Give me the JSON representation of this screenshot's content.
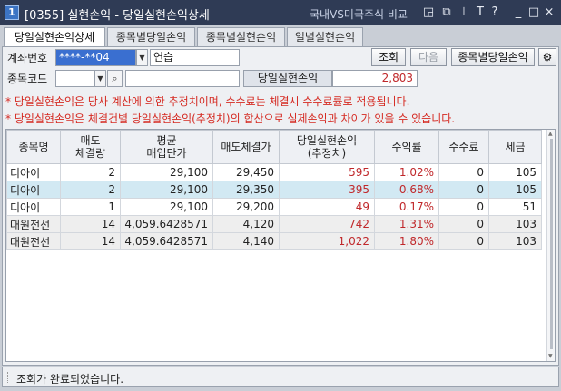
{
  "window": {
    "number_badge": "1",
    "title": "[0355] 실현손익 - 당일실현손익상세",
    "compare_link": "국내VS미국주식 비교",
    "controls": [
      "?",
      "_",
      "□",
      "×"
    ]
  },
  "tabs": [
    {
      "label": "당일실현손익상세",
      "active": true
    },
    {
      "label": "종목별당일손익",
      "active": false
    },
    {
      "label": "종목별실현손익",
      "active": false
    },
    {
      "label": "일별실현손익",
      "active": false
    }
  ],
  "form": {
    "account_label": "계좌번호",
    "account_value": "****-**04",
    "account_name": "연습",
    "stock_label": "종목코드",
    "stock_value": "",
    "stock_name": "",
    "query_button": "조회",
    "next_button": "다음",
    "by_stock_button": "종목별당일손익",
    "sum_label": "당일실현손익",
    "sum_value": "2,803"
  },
  "notices": [
    "* 당일실현손익은 당사 계산에 의한 추정치이며, 수수료는 체결시 수수료률로 적용됩니다.",
    "* 당일실현손익은 체결건별 당일실현손익(추정치)의 합산으로 실제손익과 차이가 있을 수 있습니다."
  ],
  "table": {
    "columns": [
      [
        "종목명"
      ],
      [
        "매도",
        "체결량"
      ],
      [
        "평균",
        "매입단가"
      ],
      [
        "매도체결가"
      ],
      [
        "당일실현손익",
        "(추정치)"
      ],
      [
        "수익률"
      ],
      [
        "수수료"
      ],
      [
        "세금"
      ]
    ],
    "rows": [
      [
        "디아이",
        "2",
        "29,100",
        "29,450",
        "595",
        "1.02%",
        "0",
        "105"
      ],
      [
        "디아이",
        "2",
        "29,100",
        "29,350",
        "395",
        "0.68%",
        "0",
        "105"
      ],
      [
        "디아이",
        "1",
        "29,100",
        "29,200",
        "49",
        "0.17%",
        "0",
        "51"
      ],
      [
        "대원전선",
        "14",
        "4,059.6428571",
        "4,120",
        "742",
        "1.31%",
        "0",
        "103"
      ],
      [
        "대원전선",
        "14",
        "4,059.6428571",
        "4,140",
        "1,022",
        "1.80%",
        "0",
        "103"
      ]
    ],
    "selected_row": 1,
    "colors": {
      "profit": "#c0282b",
      "selected_row": "#d2e9f3"
    }
  },
  "status": {
    "message": "조회가 완료되었습니다."
  }
}
